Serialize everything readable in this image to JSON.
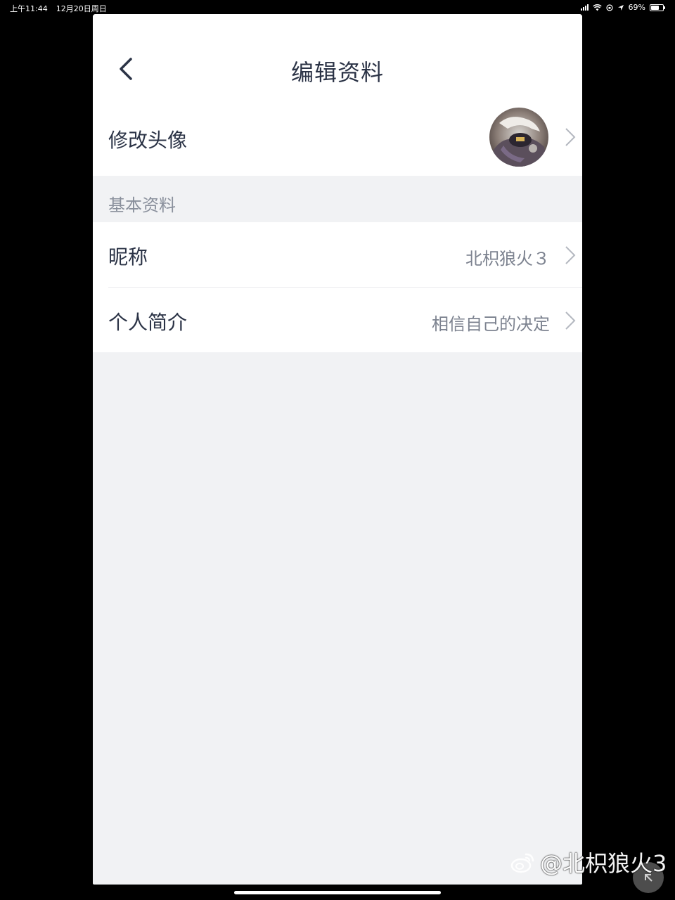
{
  "status_bar": {
    "time": "上午11:44",
    "date": "12月20日周日",
    "battery": "69%",
    "battery_level": 0.69
  },
  "nav": {
    "title": "编辑资料",
    "back_icon": "chevron-left-icon"
  },
  "avatar_row": {
    "label": "修改头像"
  },
  "section": {
    "title": "基本资料"
  },
  "nickname_row": {
    "label": "昵称",
    "value": "北枳狼火３"
  },
  "bio_row": {
    "label": "个人简介",
    "value": "相信自己的决定"
  },
  "watermark": {
    "text": "@北枳狼火3"
  },
  "colors": {
    "background": "#f1f2f4",
    "surface": "#ffffff",
    "text_primary": "#2b3346",
    "text_secondary": "#7c828f"
  }
}
